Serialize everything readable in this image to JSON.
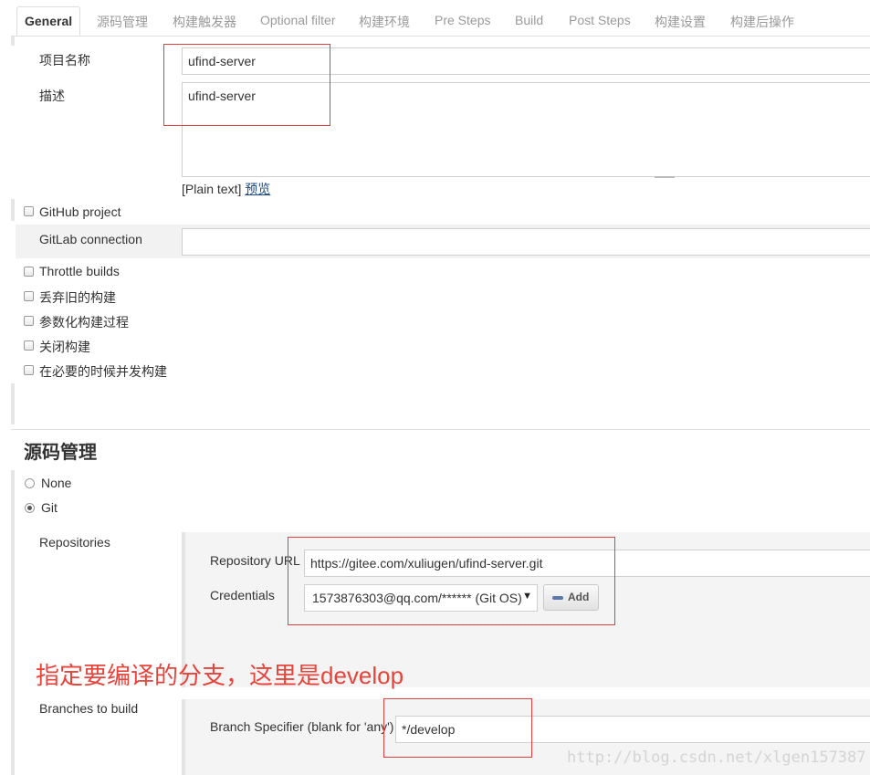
{
  "tabs": [
    "General",
    "源码管理",
    "构建触发器",
    "Optional filter",
    "构建环境",
    "Pre Steps",
    "Build",
    "Post Steps",
    "构建设置",
    "构建后操作"
  ],
  "general": {
    "project_name_label": "项目名称",
    "project_name_value": "ufind-server",
    "description_label": "描述",
    "description_value": "ufind-server",
    "plain_text": "[Plain text]",
    "preview": "预览",
    "github_project": "GitHub project",
    "gitlab_connection_label": "GitLab connection",
    "gitlab_connection_value": "",
    "options": [
      "Throttle builds",
      "丢弃旧的构建",
      "参数化构建过程",
      "关闭构建",
      "在必要的时候并发构建"
    ]
  },
  "scm": {
    "title": "源码管理",
    "none_label": "None",
    "git_label": "Git",
    "selected": "Git",
    "repositories_label": "Repositories",
    "repo_url_label": "Repository URL",
    "repo_url_value": "https://gitee.com/xuliugen/ufind-server.git",
    "credentials_label": "Credentials",
    "credentials_value": "1573876303@qq.com/****** (Git OS)",
    "add_button": "Add",
    "branches_label": "Branches to build",
    "branch_specifier_label": "Branch Specifier (blank for 'any')",
    "branch_specifier_value": "*/develop"
  },
  "annotation": "指定要编译的分支，这里是develop",
  "watermark": "http://blog.csdn.net/xlgen157387",
  "colors": {
    "annotation": "#e8443c",
    "link": "#204a87",
    "active_tab_text": "#333333",
    "inactive_tab_text": "#9a9a9a"
  },
  "icons": {
    "add": "key-icon",
    "select": "chevron-down-icon"
  }
}
